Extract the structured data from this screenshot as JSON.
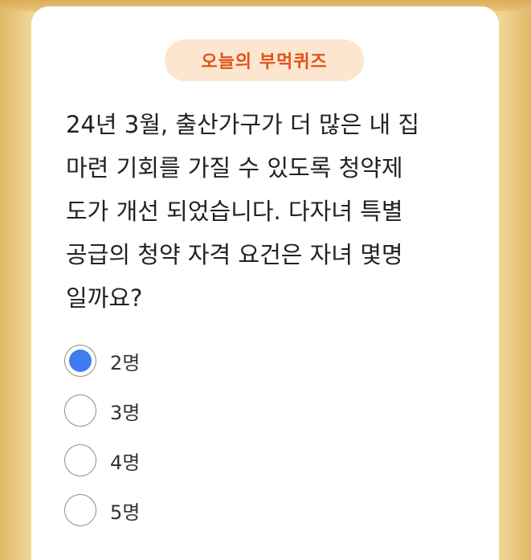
{
  "quiz": {
    "badge_label": "오늘의 부먹퀴즈",
    "question": "24년 3월, 출산가구가 더 많은 내 집\n마련 기회를 가질 수 있도록 청약제\n도가 개선 되었습니다. 다자녀 특별\n공급의 청약 자격 요건은 자녀 몇명\n일까요?",
    "options": [
      {
        "label": "2명",
        "selected": true
      },
      {
        "label": "3명",
        "selected": false
      },
      {
        "label": "4명",
        "selected": false
      },
      {
        "label": "5명",
        "selected": false
      }
    ]
  },
  "colors": {
    "accent": "#3f7bf2",
    "badge_text": "#e0531a",
    "badge_bg": "#fde6cf",
    "background": "#f3dc9c"
  }
}
